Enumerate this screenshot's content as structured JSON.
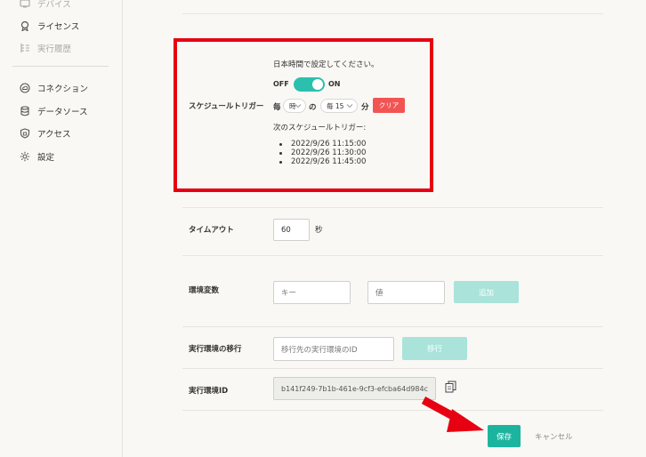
{
  "sidebar": {
    "items": [
      {
        "label": "デバイス",
        "icon": "device-icon",
        "muted": true
      },
      {
        "label": "ライセンス",
        "icon": "license-icon",
        "muted": false
      },
      {
        "label": "実行履歴",
        "icon": "history-icon",
        "muted": true
      },
      {
        "label": "コネクション",
        "icon": "cloud-icon",
        "muted": false
      },
      {
        "label": "データソース",
        "icon": "database-icon",
        "muted": false
      },
      {
        "label": "アクセス",
        "icon": "shield-icon",
        "muted": false
      },
      {
        "label": "設定",
        "icon": "gear-icon",
        "muted": false
      }
    ]
  },
  "schedule": {
    "label": "スケジュールトリガー",
    "timezone_note": "日本時間で設定してください。",
    "toggle_off": "OFF",
    "toggle_on": "ON",
    "toggle_state": "on",
    "every_prefix": "毎",
    "hour_select": "時",
    "particle": "の",
    "minute_select": "毎 15",
    "minute_suffix": "分",
    "clear_label": "クリア",
    "next_label": "次のスケジュールトリガー:",
    "next_runs": [
      "2022/9/26 11:15:00",
      "2022/9/26 11:30:00",
      "2022/9/26 11:45:00"
    ]
  },
  "timeout": {
    "label": "タイムアウト",
    "value": "60",
    "unit": "秒"
  },
  "env_vars": {
    "label": "環境変数",
    "key_placeholder": "キー",
    "value_placeholder": "値",
    "add_label": "追加"
  },
  "migration": {
    "label": "実行環境の移行",
    "placeholder": "移行先の実行環境のID",
    "button_label": "移行"
  },
  "env_id": {
    "label": "実行環境ID",
    "value": "b141f249-7b1b-461e-9cf3-efcba64d984c"
  },
  "actions": {
    "save_label": "保存",
    "cancel_label": "キャンセル"
  },
  "colors": {
    "accent": "#1db49f",
    "highlight": "#e60012",
    "clear": "#f25454"
  }
}
